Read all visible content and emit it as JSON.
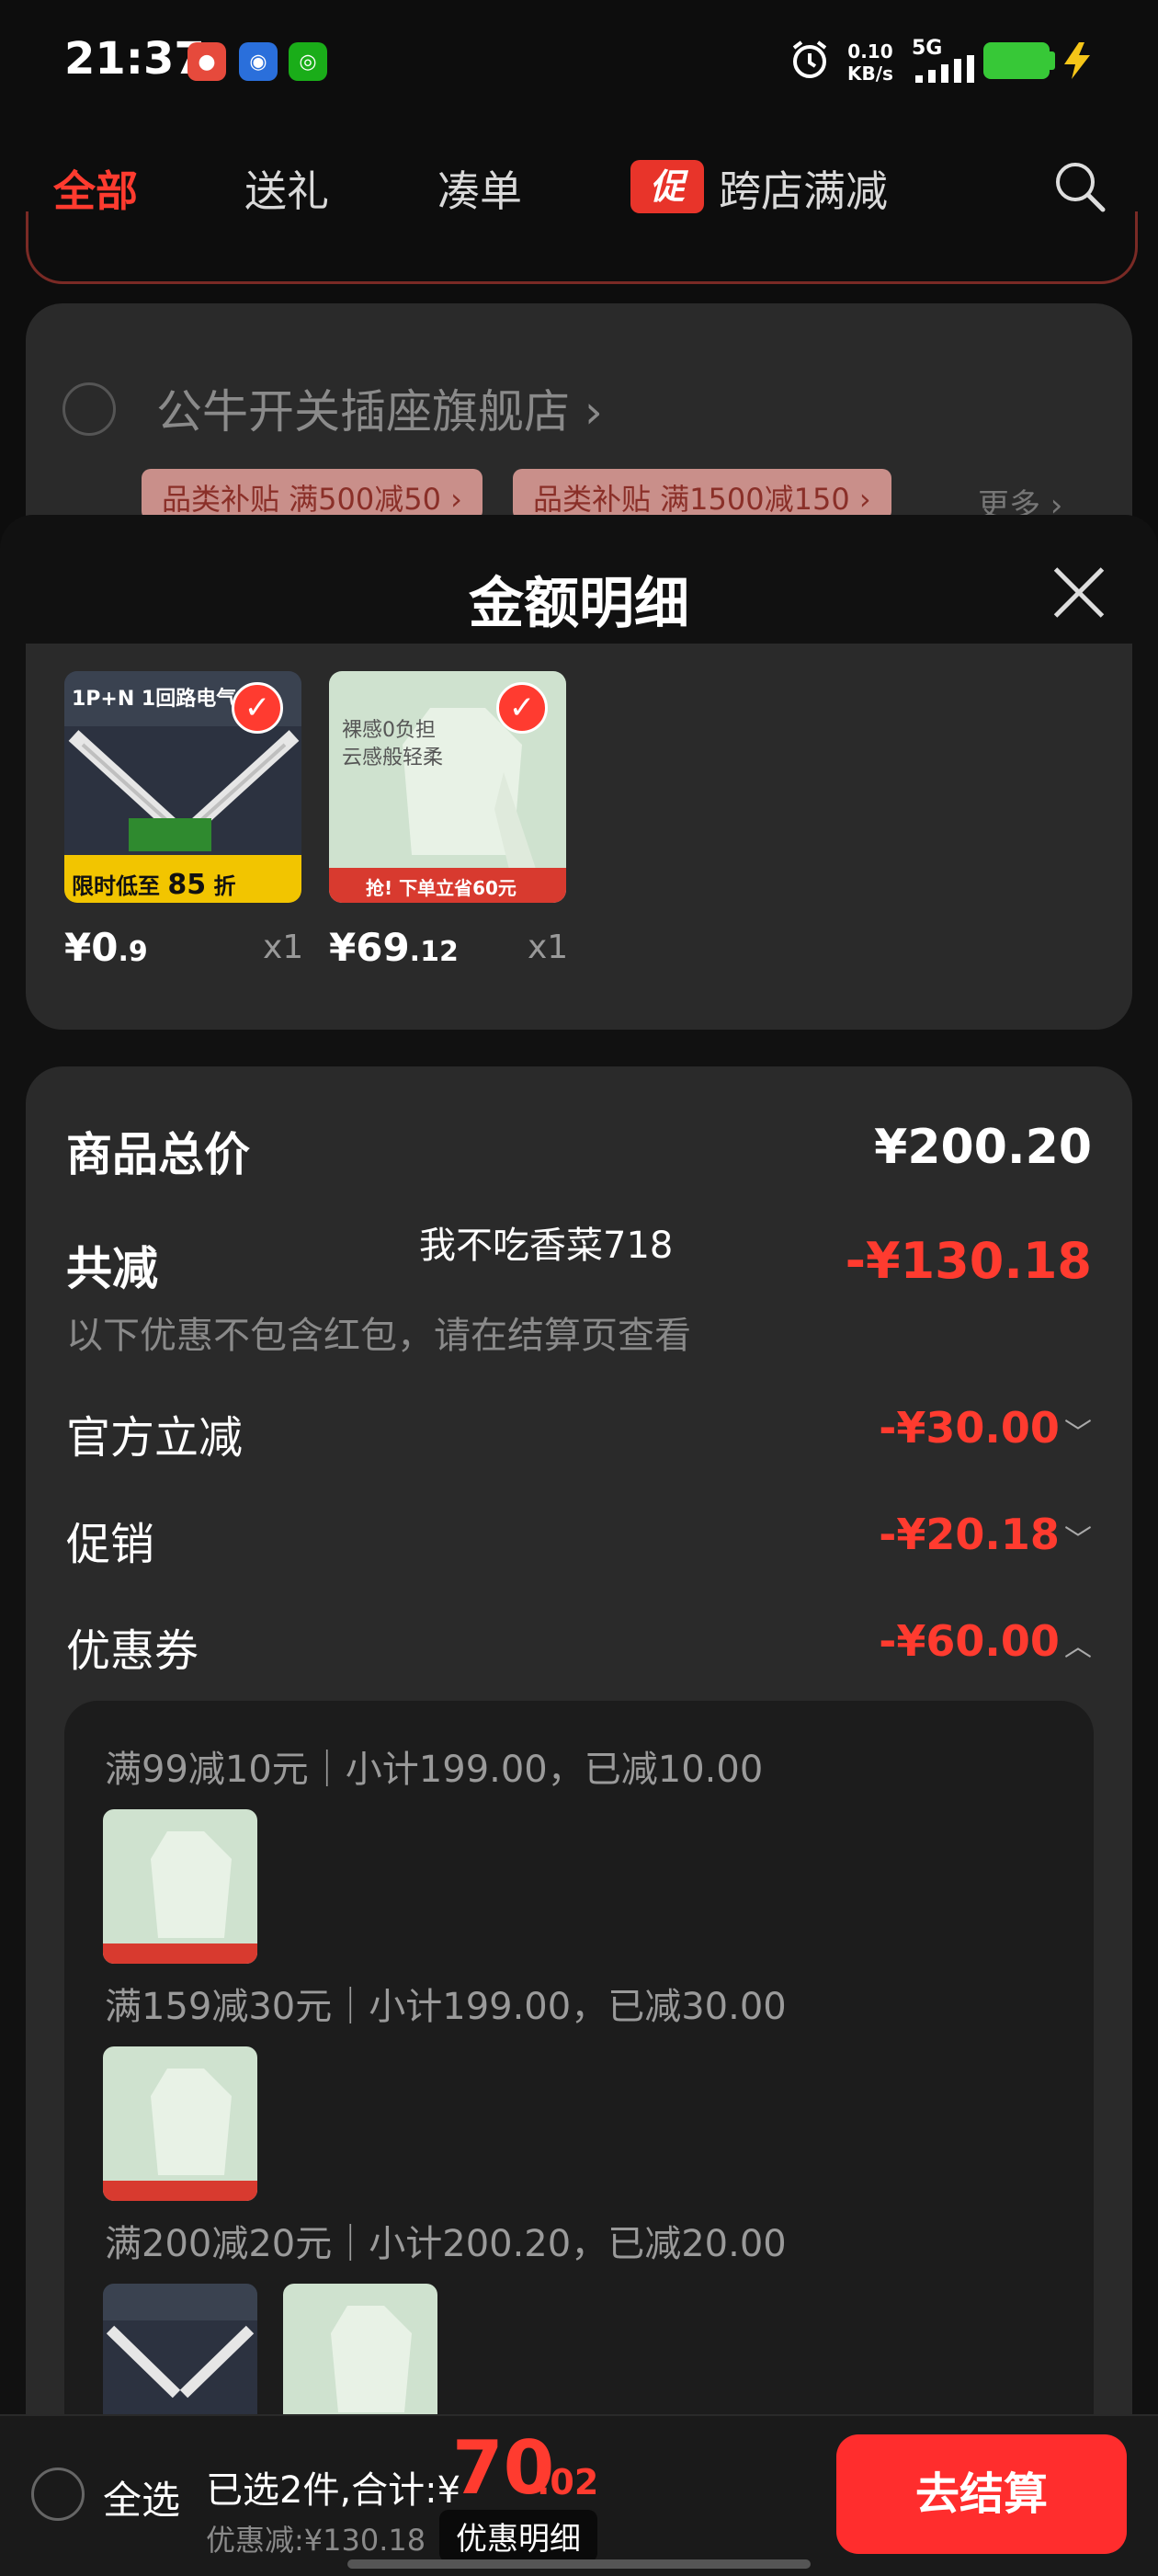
{
  "status_bar": {
    "time": "21:37",
    "net_speed": "0.10",
    "net_unit": "KB/s",
    "signal": "5G",
    "icons": [
      "alarm-icon",
      "signal-icon",
      "battery-icon",
      "charging-icon"
    ]
  },
  "top_tabs": [
    {
      "label": "全部",
      "active": true
    },
    {
      "label": "送礼",
      "active": false
    },
    {
      "label": "凑单",
      "active": false
    },
    {
      "label": "跨店满减",
      "badge": "促",
      "active": false
    }
  ],
  "store": {
    "name": "公牛开关插座旗舰店",
    "coupons": [
      "品类补贴 满500减50",
      "品类补贴 满1500减150"
    ],
    "more": "更多"
  },
  "sheet": {
    "title": "金额明细",
    "items": [
      {
        "price_int": "¥0",
        "price_dec": ".9",
        "qty": "x1",
        "banner": "限时低至",
        "discount": "85",
        "discount_unit": "折",
        "thumb_title": "1P+N 1回路电气"
      },
      {
        "price_int": "¥69",
        "price_dec": ".12",
        "qty": "x1",
        "thumb_line1": "裸感0负担",
        "thumb_line2": "云感般轻柔",
        "thumb_cta": "抢! 下单立省60元"
      }
    ],
    "summary": {
      "total_label": "商品总价",
      "total_value": "¥200.20",
      "reduce_label": "共减",
      "reduce_value": "-¥130.18",
      "watermark": "我不吃香菜718",
      "note": "以下优惠不包含红包，请在结算页查看",
      "official_label": "官方立减",
      "official_value": "-¥30.00",
      "promo_label": "促销",
      "promo_value": "-¥20.18",
      "coupon_label": "优惠券",
      "coupon_value": "-¥60.00"
    },
    "coupon_groups": [
      {
        "text": "满99减10元｜小计199.00，已减10.00"
      },
      {
        "text": "满159减30元｜小计199.00，已减30.00"
      },
      {
        "text": "满200减20元｜小计200.20，已减20.00"
      }
    ]
  },
  "bottom_bar": {
    "select_all": "全选",
    "selected": "已选2件,合计:¥",
    "total_int": "70",
    "total_dec": ".02",
    "saved": "优惠减:¥130.18",
    "detail_link": "优惠明细",
    "checkout": "去结算"
  },
  "colors": {
    "accent": "#ff3b2f",
    "checkout": "#ff2d2d",
    "card": "#2a2a2a",
    "background": "#111111"
  }
}
